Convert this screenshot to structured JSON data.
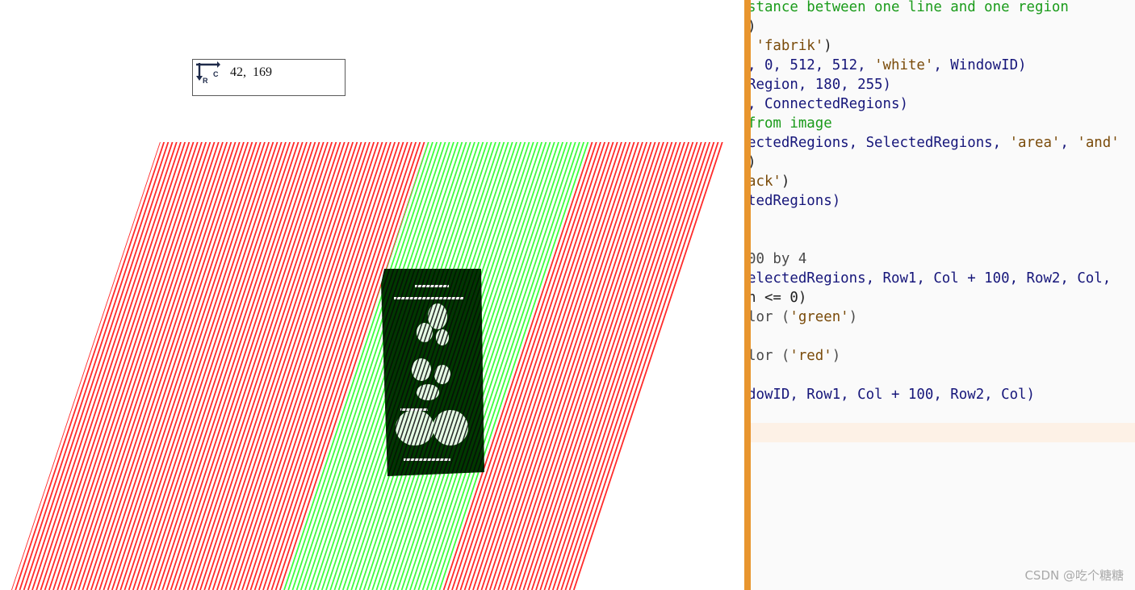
{
  "graphics_window": {
    "coordinate_readout": {
      "row_col": "42,  169",
      "icon_letters": {
        "r": "R",
        "c": "C"
      }
    },
    "stripe_bands": [
      {
        "color": "#ff2a2a"
      },
      {
        "color": "#3dff3d"
      },
      {
        "color": "#ff2a2a"
      }
    ],
    "region_color": "#003a00"
  },
  "splitter": {
    "color": "#e8952e"
  },
  "editor": {
    "lines": [
      [
        {
          "t": "stance between one line and one region",
          "c": "cmt"
        }
      ],
      [
        {
          "t": ")",
          "c": "op"
        }
      ],
      [
        {
          "t": " 'fabrik'",
          "c": "str"
        },
        {
          "t": ")",
          "c": "op"
        }
      ],
      [
        {
          "t": ", 0, 512, 512, ",
          "c": "var"
        },
        {
          "t": "'white'",
          "c": "str"
        },
        {
          "t": ", WindowID)",
          "c": "var"
        }
      ],
      [
        {
          "t": "Region, 180, 255)",
          "c": "var"
        }
      ],
      [
        {
          "t": ", ConnectedRegions)",
          "c": "var"
        }
      ],
      [
        {
          "t": "from image",
          "c": "cmt"
        }
      ],
      [
        {
          "t": "ectedRegions, SelectedRegions, ",
          "c": "var"
        },
        {
          "t": "'area'",
          "c": "str"
        },
        {
          "t": ", ",
          "c": "var"
        },
        {
          "t": "'and'",
          "c": "str"
        }
      ],
      [
        {
          "t": ")",
          "c": "op"
        }
      ],
      [
        {
          "t": "ack'",
          "c": "str"
        },
        {
          "t": ")",
          "c": "op"
        }
      ],
      [
        {
          "t": "tedRegions)",
          "c": "var"
        }
      ],
      [
        {
          "t": "",
          "c": "op"
        }
      ],
      [
        {
          "t": "",
          "c": "op"
        }
      ],
      [
        {
          "t": "00 by 4",
          "c": "kw"
        }
      ],
      [
        {
          "t": "electedRegions, Row1, Col + 100, Row2, Col,",
          "c": "var"
        }
      ],
      [
        {
          "t": "n <= 0)",
          "c": "op"
        }
      ],
      [
        {
          "t": "lor (",
          "c": "kw"
        },
        {
          "t": "'green'",
          "c": "str"
        },
        {
          "t": ")",
          "c": "kw"
        }
      ],
      [
        {
          "t": "",
          "c": "op"
        }
      ],
      [
        {
          "t": "lor (",
          "c": "kw"
        },
        {
          "t": "'red'",
          "c": "str"
        },
        {
          "t": ")",
          "c": "kw"
        }
      ],
      [
        {
          "t": "",
          "c": "op"
        }
      ],
      [
        {
          "t": "dowID, Row1, Col + 100, Row2, Col)",
          "c": "var"
        }
      ]
    ],
    "watermark": "CSDN @吃个糖糖"
  }
}
